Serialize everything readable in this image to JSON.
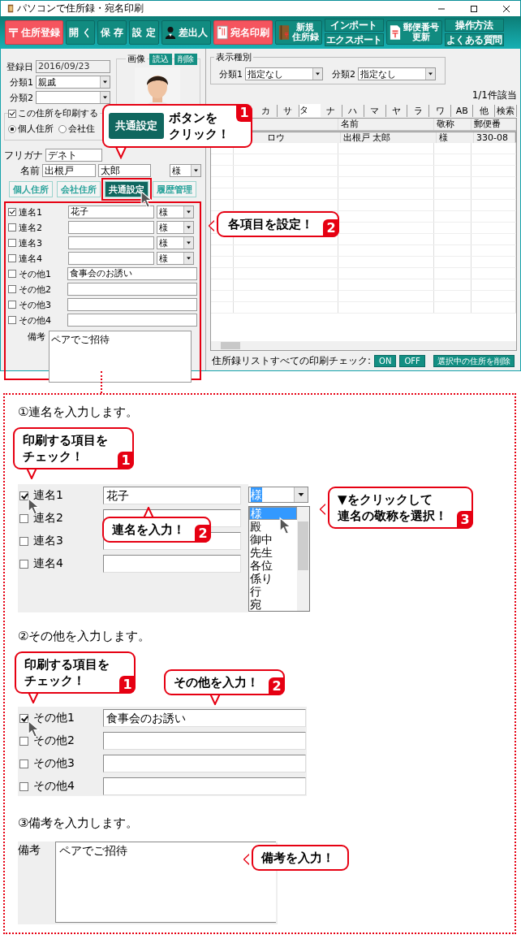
{
  "window": {
    "title": "パソコンで住所録・宛名印刷"
  },
  "toolbar": [
    {
      "kind": "post",
      "label": "住所登録"
    },
    {
      "kind": "plain",
      "label": "開 く"
    },
    {
      "kind": "plain",
      "label": "保 存"
    },
    {
      "kind": "plain",
      "label": "設 定"
    },
    {
      "kind": "person",
      "label": "差出人"
    },
    {
      "kind": "card",
      "label": "宛名印刷"
    },
    {
      "kind": "book",
      "lines": [
        "新規",
        "住所録"
      ]
    },
    {
      "kind": "stack",
      "buttons": [
        "インポート",
        "エクスポート"
      ]
    },
    {
      "kind": "postal",
      "lines": [
        "郵便番号",
        "更新"
      ]
    },
    {
      "kind": "stack",
      "buttons": [
        "操作方法",
        "よくある質問"
      ]
    }
  ],
  "record": {
    "date_label": "登録日",
    "date": "2016/09/23",
    "category1_label": "分類1",
    "category1": "親戚",
    "category2_label": "分類2"
  },
  "image": {
    "label": "画像",
    "buttons": [
      "読込",
      "削除"
    ]
  },
  "print_group": {
    "label": "この住所を印刷する",
    "checked": true,
    "options": [
      {
        "label": "個人住所",
        "selected": true
      },
      {
        "label": "会社住",
        "selected": false
      }
    ]
  },
  "furigana": {
    "label": "フリガナ",
    "value": "デネト"
  },
  "name": {
    "label": "名前",
    "last": "出根戸",
    "first": "太郎",
    "honorific": "様"
  },
  "tabs": [
    {
      "label": "個人住所",
      "selected": false
    },
    {
      "label": "会社住所",
      "selected": false
    },
    {
      "label": "共通設定",
      "selected": true
    },
    {
      "label": "履歴管理",
      "selected": false
    }
  ],
  "joint_names": [
    {
      "label": "連名1",
      "checked": true,
      "value": "花子",
      "honorific": "様"
    },
    {
      "label": "連名2",
      "checked": false,
      "honorific": "様"
    },
    {
      "label": "連名3",
      "checked": false,
      "honorific": "様"
    },
    {
      "label": "連名4",
      "checked": false,
      "honorific": "様"
    }
  ],
  "others": [
    {
      "label": "その他1",
      "checked": false,
      "value": "食事会のお誘い"
    },
    {
      "label": "その他2",
      "checked": false
    },
    {
      "label": "その他3",
      "checked": false
    },
    {
      "label": "その他4",
      "checked": false
    }
  ],
  "memo": {
    "label": "備考",
    "value": "ペアでご招待"
  },
  "display_filter": {
    "label": "表示種別",
    "category1_label": "分類1",
    "category1": "指定なし",
    "category2_label": "分類2",
    "category2": "指定なし"
  },
  "count": "1/1件該当",
  "kana_tabs": [
    {
      "label": "カ",
      "selected": false
    },
    {
      "label": "サ",
      "selected": false
    },
    {
      "label": "タ",
      "selected": true
    },
    {
      "label": "ナ",
      "selected": false
    },
    {
      "label": "ハ",
      "selected": false
    },
    {
      "label": "マ",
      "selected": false
    },
    {
      "label": "ヤ",
      "selected": false
    },
    {
      "label": "ラ",
      "selected": false
    },
    {
      "label": "ワ",
      "selected": false
    },
    {
      "label": "AB",
      "selected": false
    },
    {
      "label": "他",
      "selected": false
    },
    {
      "label": "検索",
      "selected": false
    }
  ],
  "table": {
    "columns": [
      "",
      "",
      "名前",
      "敬称",
      "郵便番"
    ],
    "rows": [
      [
        "",
        "ロウ",
        "出根戸 太郎",
        "様",
        "330-08"
      ]
    ]
  },
  "footer": {
    "label": "住所録リストすべての印刷チェック:",
    "on": "ON",
    "off": "OFF",
    "delete": "選択中の住所を削除"
  },
  "callouts": [
    {
      "lines": [
        "ボタンを",
        "クリック！"
      ],
      "badge": "1",
      "button": "共通設定"
    },
    {
      "lines": [
        "各項目を設定！"
      ],
      "badge": "2"
    }
  ],
  "step1": {
    "heading": "①連名を入力します。",
    "callouts": [
      {
        "lines": [
          "印刷する項目を",
          "チェック！"
        ],
        "badge": "1"
      },
      {
        "lines": [
          "連名を入力！"
        ],
        "badge": "2"
      },
      {
        "lines": [
          "▼をクリックして",
          "連名の敬称を選択！"
        ],
        "badge": "3"
      }
    ],
    "rows": [
      {
        "label": "連名1",
        "checked": true,
        "value": "花子"
      },
      {
        "label": "連名2",
        "checked": false
      },
      {
        "label": "連名3",
        "checked": false
      },
      {
        "label": "連名4",
        "checked": false
      }
    ],
    "honorific": "様",
    "options": [
      {
        "label": "様",
        "selected": true
      },
      {
        "label": "殿",
        "selected": false
      },
      {
        "label": "御中",
        "selected": false
      },
      {
        "label": "先生",
        "selected": false
      },
      {
        "label": "各位",
        "selected": false
      },
      {
        "label": "係り",
        "selected": false
      },
      {
        "label": "行",
        "selected": false
      },
      {
        "label": "宛",
        "selected": false
      }
    ]
  },
  "step2": {
    "heading": "②その他を入力します。",
    "callouts": [
      {
        "lines": [
          "印刷する項目を",
          "チェック！"
        ],
        "badge": "1"
      },
      {
        "lines": [
          "その他を入力！"
        ],
        "badge": "2"
      }
    ],
    "rows": [
      {
        "label": "その他1",
        "checked": true,
        "value": "食事会のお誘い"
      },
      {
        "label": "その他2",
        "checked": false
      },
      {
        "label": "その他3",
        "checked": false
      },
      {
        "label": "その他4",
        "checked": false
      }
    ]
  },
  "step3": {
    "heading": "③備考を入力します。",
    "label": "備考",
    "value": "ペアでご招待",
    "callouts": [
      {
        "lines": [
          "備考を入力！"
        ]
      }
    ]
  }
}
